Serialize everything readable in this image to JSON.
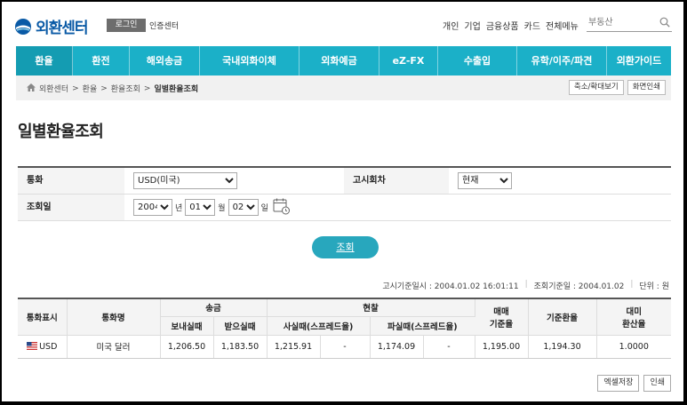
{
  "header": {
    "logo_text": "외환센터",
    "login_label": "로그인",
    "cert_label": "인증센터",
    "topnav": [
      "개인",
      "기업",
      "금융상품",
      "카드",
      "전체메뉴"
    ],
    "search_placeholder": "부동산"
  },
  "mainnav": {
    "items": [
      {
        "label": "환율",
        "width": 64
      },
      {
        "label": "환전",
        "width": 64
      },
      {
        "label": "해외송금",
        "width": 79
      },
      {
        "label": "국내외화이체",
        "width": 112
      },
      {
        "label": "외화예금",
        "width": 90
      },
      {
        "label": "eZ-FX",
        "width": 66
      },
      {
        "label": "수출입",
        "width": 89
      },
      {
        "label": "유학/이주/파견",
        "width": 101
      },
      {
        "label": "외환가이드",
        "width": 72
      }
    ]
  },
  "breadcrumb": {
    "items": [
      "외환센터",
      "환율",
      "환율조회",
      "일별환율조회"
    ],
    "sep": ">",
    "zoom_label": "축소/확대보기",
    "print_label": "화면인쇄"
  },
  "page_title": "일별환율조회",
  "form": {
    "currency_label": "통화",
    "currency_value": "USD(미국)",
    "notice_label": "고시회차",
    "notice_value": "현재",
    "date_label": "조회일",
    "year": "2004",
    "year_unit": "년",
    "month": "01",
    "month_unit": "월",
    "day": "02",
    "day_unit": "일"
  },
  "query_button": "조회",
  "basis": {
    "notice_time": "고시기준일시 : 2004.01.02 16:01:11",
    "query_date": "조회기준일 : 2004.01.02",
    "unit": "단위 : 원"
  },
  "table": {
    "headers": {
      "currency": "통화표시",
      "name": "통화명",
      "remit": "송금",
      "send": "보내실때",
      "receive": "받으실때",
      "cash": "현찰",
      "buy": "사실때(스프레드율)",
      "sell": "파실때(스프레드율)",
      "trade_1": "매매",
      "trade_2": "기준율",
      "base": "기준환율",
      "usd_1": "대미",
      "usd_2": "환산율"
    },
    "rows": [
      {
        "code": "USD",
        "name": "미국 달러",
        "send": "1,206.50",
        "receive": "1,183.50",
        "cash_buy": "1,215.91",
        "cash_buy_spread": "-",
        "cash_sell": "1,174.09",
        "cash_sell_spread": "-",
        "trade_rate": "1,195.00",
        "base_rate": "1,194.30",
        "usd_rate": "1.0000"
      }
    ]
  },
  "bottom": {
    "excel_label": "엑셀저장",
    "print_label": "인쇄"
  },
  "colors": {
    "nav": "#1bb0c8",
    "button": "#28a7bd",
    "logo": "#0a5aa6"
  }
}
